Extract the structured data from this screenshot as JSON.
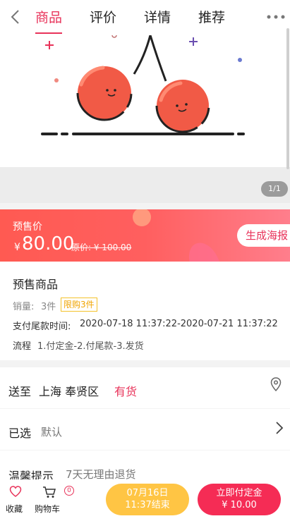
{
  "header": {
    "tabs": [
      {
        "label": "商品",
        "active": true
      },
      {
        "label": "评价",
        "active": false
      },
      {
        "label": "详情",
        "active": false
      },
      {
        "label": "推荐",
        "active": false
      }
    ]
  },
  "gallery": {
    "counter": "1/1"
  },
  "price_banner": {
    "presale_label": "预售价",
    "currency": "¥",
    "price": "80.00",
    "original_price": "原价: ¥ 100.00",
    "poster_button": "生成海报"
  },
  "product": {
    "name": "预售商品",
    "sales_label": "销量:",
    "sales_value": "3件",
    "limit_badge": "限购3件",
    "pay_time_label": "支付尾款时间:",
    "pay_time_value": "2020-07-18 11:37:22-2020-07-21 11:37:22",
    "process_label": "流程",
    "process_value": "1.付定金-2.付尾款-3.发货"
  },
  "delivery": {
    "label": "送至",
    "location": "上海 奉贤区",
    "stock": "有货"
  },
  "selected": {
    "label": "已选",
    "value": "默认"
  },
  "tips": {
    "label": "温馨提示",
    "value": "7天无理由退货"
  },
  "bottom_bar": {
    "favorite_label": "收藏",
    "cart_label": "购物车",
    "cart_badge": "0",
    "time_button_line1": "07月16日",
    "time_button_line2": "11:37结束",
    "pay_button_line1": "立即付定金",
    "pay_button_line2": "¥ 10.00"
  },
  "colors": {
    "accent": "#e8335a",
    "time_button": "#ffc544",
    "pay_button": "#f52c55"
  }
}
